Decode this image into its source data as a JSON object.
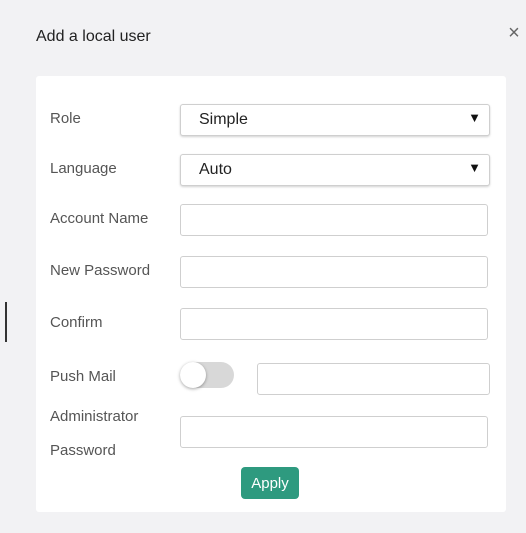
{
  "dialog": {
    "title": "Add a local user",
    "close_glyph": "×"
  },
  "form": {
    "role": {
      "label": "Role",
      "value": "Simple"
    },
    "language": {
      "label": "Language",
      "value": "Auto"
    },
    "account_name": {
      "label": "Account Name",
      "value": ""
    },
    "new_password": {
      "label": "New Password",
      "value": ""
    },
    "confirm": {
      "label": "Confirm",
      "value": ""
    },
    "push_mail": {
      "label": "Push Mail",
      "enabled": false,
      "value": ""
    },
    "admin_password": {
      "label_line1": "Administrator",
      "label_line2": "Password",
      "value": ""
    },
    "apply_label": "Apply"
  },
  "icons": {
    "close": "close-icon",
    "dropdown": "chevron-down-icon"
  },
  "colors": {
    "accent": "#2e9a7f",
    "background": "#f2f2f4",
    "card": "#ffffff"
  }
}
